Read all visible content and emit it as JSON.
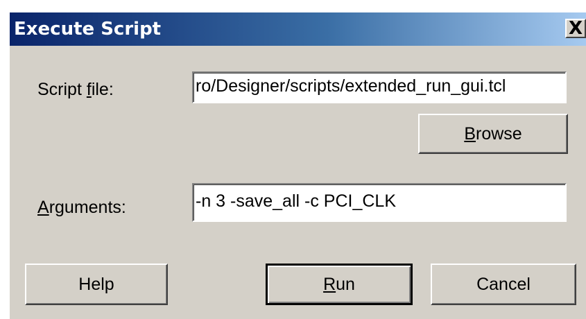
{
  "window": {
    "title": "Execute Script",
    "close_glyph": "X",
    "close_icon": "close-icon"
  },
  "fields": {
    "script_file_label": "Script file:",
    "script_file_value": "ro/Designer/scripts/extended_run_gui.tcl",
    "arguments_label": "Arguments:",
    "arguments_value": "-n 3 -save_all -c PCI_CLK"
  },
  "buttons": {
    "browse": "Browse",
    "help": "Help",
    "run": "Run",
    "cancel": "Cancel"
  }
}
